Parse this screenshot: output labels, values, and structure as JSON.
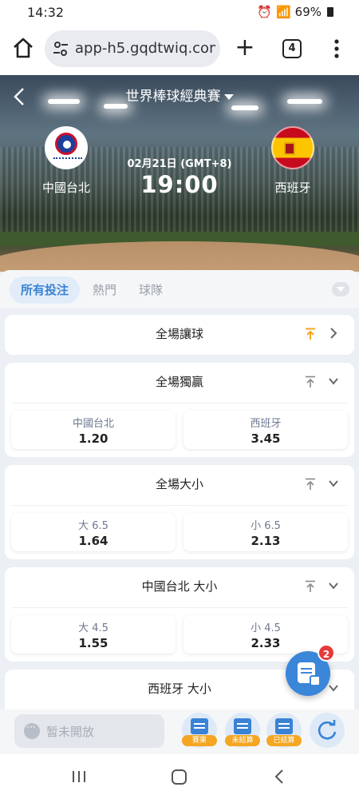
{
  "status_bar": {
    "time": "14:32",
    "battery": "69%"
  },
  "browser": {
    "url": "app-h5.gqdtwiq.com",
    "tab_count": "4"
  },
  "match": {
    "tournament": "世界棒球經典賽",
    "date": "02月21日 (GMT+8)",
    "time": "19:00",
    "home_team": "中國台北",
    "away_team": "西班牙"
  },
  "tabs": [
    "所有投注",
    "熱門",
    "球隊"
  ],
  "markets": [
    {
      "title": "全場讓球",
      "pinned": true,
      "expanded": false,
      "selections": []
    },
    {
      "title": "全場獨贏",
      "pinned": false,
      "expanded": true,
      "selections": [
        {
          "label": "中國台北",
          "odds": "1.20"
        },
        {
          "label": "西班牙",
          "odds": "3.45"
        }
      ]
    },
    {
      "title": "全場大小",
      "pinned": false,
      "expanded": true,
      "selections": [
        {
          "label": "大 6.5",
          "odds": "1.64"
        },
        {
          "label": "小 6.5",
          "odds": "2.13"
        }
      ]
    },
    {
      "title": "中國台北 大小",
      "pinned": false,
      "expanded": true,
      "selections": [
        {
          "label": "大 4.5",
          "odds": "1.55"
        },
        {
          "label": "小 4.5",
          "odds": "2.33"
        }
      ]
    },
    {
      "title": "西班牙 大小",
      "pinned": false,
      "expanded": true,
      "selections": []
    }
  ],
  "bet_slip": {
    "count": "2"
  },
  "bottom_bar": {
    "chat_placeholder": "暂未開放",
    "results_label": "賽果",
    "unsettled_label": "未結算",
    "settled_label": "已結算"
  },
  "colors": {
    "accent": "#3a82d6",
    "pin_active": "#f5a623",
    "badge": "#e83a3a"
  }
}
